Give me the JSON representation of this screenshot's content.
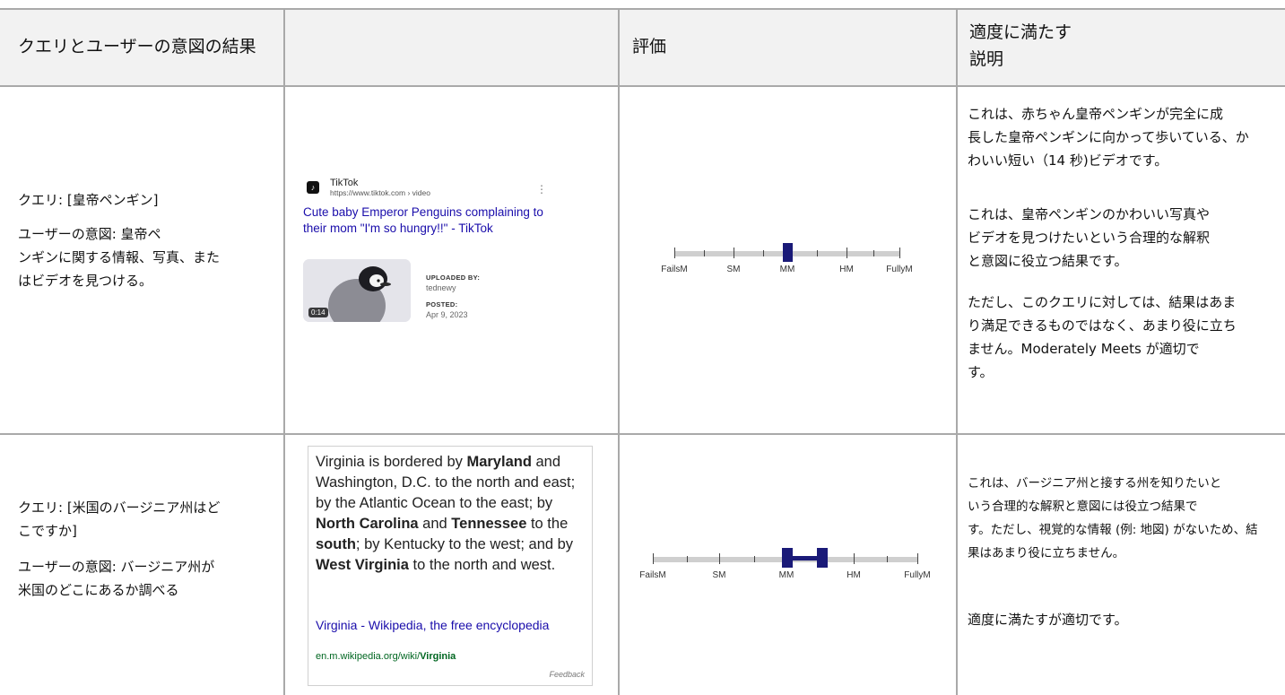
{
  "header": {
    "col1": "クエリとユーザーの意図の結果",
    "col2": "",
    "col3": "評価",
    "col4_line1": "適度に満たす",
    "col4_line2": "説明"
  },
  "row1": {
    "query": "クエリ: [皇帝ペンギン]",
    "intent": "ユーザーの意図: 皇帝ペ\nンギンに関する情報、写真、また\nはビデオを見つける。",
    "result": {
      "site_name": "TikTok",
      "site_url": "https://www.tiktok.com › video",
      "title": "Cute baby Emperor Penguins complaining to their mom \"I'm so hungry!!\" - TikTok",
      "duration": "0:14",
      "uploaded_by_label": "UPLOADED BY:",
      "uploaded_by": "tednewy",
      "posted_label": "POSTED:",
      "posted": "Apr 9, 2023"
    },
    "rating": {
      "labels": [
        "FailsM",
        "SM",
        "MM",
        "HM",
        "FullyM"
      ],
      "marker": "MM"
    },
    "explanation": [
      "これは、赤ちゃん皇帝ペンギンが完全に成\n長した皇帝ペンギンに向かって歩いている、か\nわいい短い（14 秒)ビデオです。",
      "これは、皇帝ペンギンのかわいい写真や\nビデオを見つけたいという合理的な解釈\nと意図に役立つ結果です。",
      "ただし、このクエリに対しては、結果はあま\nり満足できるものではなく、あまり役に立ち\nません。Moderately Meets が適切で\nす。"
    ]
  },
  "row2": {
    "query": "クエリ: [米国のバージニア州はど\nこですか]",
    "intent": "ユーザーの意図: バージニア州が\n米国のどこにあるか調べる",
    "result": {
      "snippet_parts": [
        {
          "text": "Virginia is bordered by ",
          "bold": false
        },
        {
          "text": "Maryland",
          "bold": true
        },
        {
          "text": " and Washington, D.C. to the north and east; by the Atlantic Ocean to the east; by ",
          "bold": false
        },
        {
          "text": "North Carolina",
          "bold": true
        },
        {
          "text": " and ",
          "bold": false
        },
        {
          "text": "Tennessee",
          "bold": true
        },
        {
          "text": " to the ",
          "bold": false
        },
        {
          "text": "south",
          "bold": true
        },
        {
          "text": "; by Kentucky to the west; and by ",
          "bold": false
        },
        {
          "text": "West Virginia",
          "bold": true
        },
        {
          "text": " to the north and west.",
          "bold": false
        }
      ],
      "title": "Virginia - Wikipedia, the free encyclopedia",
      "url_prefix": "en.m.wikipedia.org/wiki/",
      "url_bold": "Virginia",
      "feedback": "Feedback"
    },
    "rating": {
      "labels": [
        "FailsM",
        "SM",
        "MM",
        "HM",
        "FullyM"
      ],
      "range": [
        "MM",
        "MM+"
      ]
    },
    "explanation": [
      "これは、バージニア州と接する州を知りたいと\nいう合理的な解釈と意図には役立つ結果で\nす。ただし、視覚的な情報 (例: 地図) がないため、結\n果はあまり役に立ちません。",
      "適度に満たすが適切です。"
    ]
  },
  "colors": {
    "border": "#a9a9a9",
    "header_bg": "#f2f2f2",
    "marker": "#1a1a78",
    "link": "#1a0dab",
    "url_green": "#006621"
  }
}
